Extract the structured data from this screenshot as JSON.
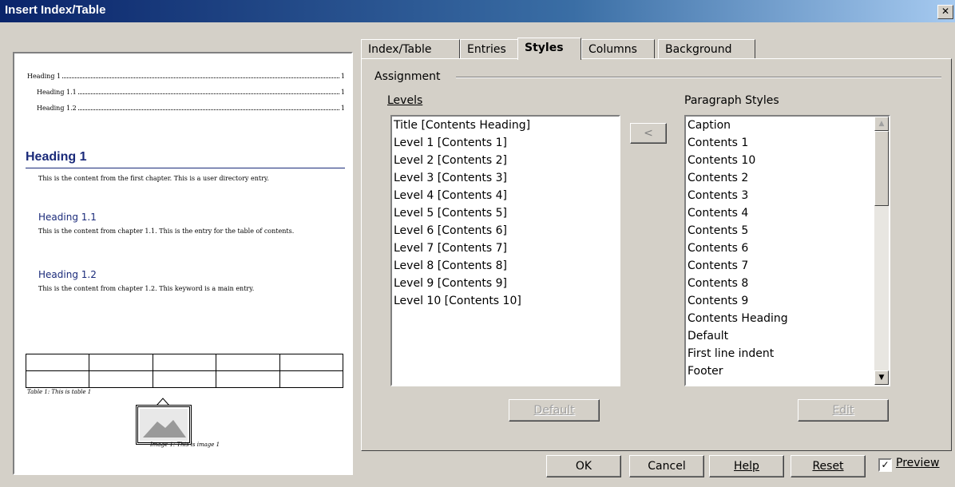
{
  "window": {
    "title": "Insert Index/Table",
    "close_icon": "close-icon",
    "close_glyph": "✕"
  },
  "preview": {
    "toc": [
      {
        "text": "Heading 1",
        "page": "1"
      },
      {
        "text": "Heading 1.1",
        "page": "1"
      },
      {
        "text": "Heading 1.2",
        "page": "1"
      }
    ],
    "heading1": "Heading 1",
    "text1": "This is the content from the first chapter. This is a user directory entry.",
    "heading11": "Heading 1.1",
    "text11": "This is the content from chapter 1.1. This is the entry for the table of contents.",
    "heading12": "Heading 1.2",
    "text12": "This is the content from chapter 1.2. This keyword is a main entry.",
    "table_caption": "Table 1: This is table 1",
    "image_caption": "Image 1: This is image 1"
  },
  "tabs": [
    {
      "label": "Index/Table",
      "active": false
    },
    {
      "label": "Entries",
      "active": false
    },
    {
      "label": "Styles",
      "active": true
    },
    {
      "label": "Columns",
      "active": false
    },
    {
      "label": "Background",
      "active": false
    }
  ],
  "assignment": {
    "group_label": "Assignment",
    "levels_label": "Levels",
    "paragraph_styles_label": "Paragraph Styles",
    "assign_glyph": "<",
    "levels": [
      "Title [Contents Heading]",
      "Level 1 [Contents 1]",
      "Level 2 [Contents 2]",
      "Level 3 [Contents 3]",
      "Level 4 [Contents 4]",
      "Level 5 [Contents 5]",
      "Level 6 [Contents 6]",
      "Level 7 [Contents 7]",
      "Level 8 [Contents 8]",
      "Level 9 [Contents 9]",
      "Level 10 [Contents 10]"
    ],
    "paragraph_styles": [
      "Caption",
      "Contents 1",
      "Contents 10",
      "Contents 2",
      "Contents 3",
      "Contents 4",
      "Contents 5",
      "Contents 6",
      "Contents 7",
      "Contents 8",
      "Contents 9",
      "Contents Heading",
      "Default",
      "First line indent",
      "Footer"
    ],
    "scroll_up_glyph": "▲",
    "scroll_down_glyph": "▼",
    "default_label": "Default",
    "edit_label": "Edit"
  },
  "footer": {
    "ok": "OK",
    "cancel": "Cancel",
    "help": "Help",
    "reset": "Reset",
    "preview_label": "Preview",
    "preview_checked": true,
    "check_glyph": "✓"
  }
}
